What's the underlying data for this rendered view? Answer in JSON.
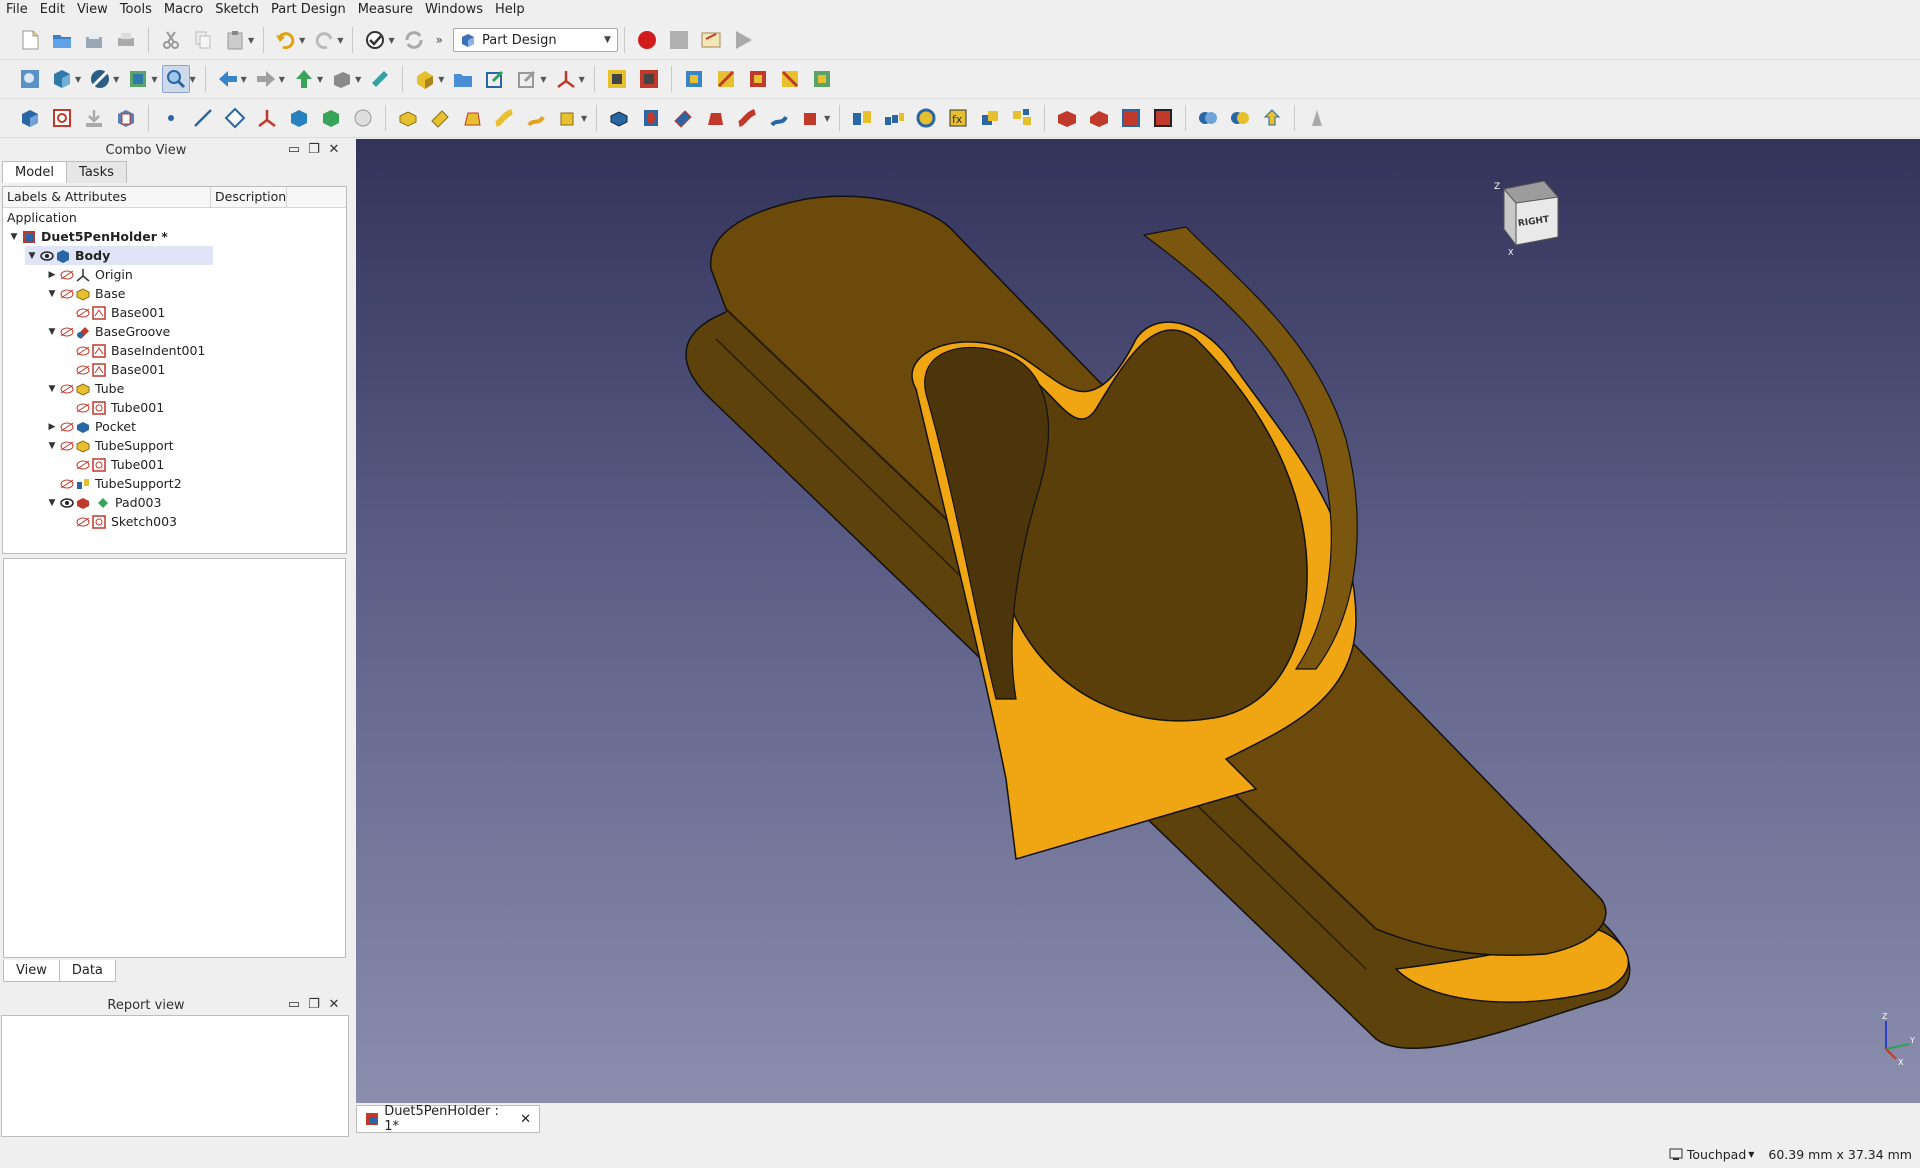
{
  "menu": [
    {
      "label": "File"
    },
    {
      "label": "Edit"
    },
    {
      "label": "View"
    },
    {
      "label": "Tools"
    },
    {
      "label": "Macro"
    },
    {
      "label": "Sketch"
    },
    {
      "label": "Part Design"
    },
    {
      "label": "Measure"
    },
    {
      "label": "Windows"
    },
    {
      "label": "Help"
    }
  ],
  "toolbar": {
    "workbench_selected": "Part Design"
  },
  "combo_view": {
    "title": "Combo View",
    "tabs": [
      "Model",
      "Tasks"
    ],
    "columns": [
      "Labels & Attributes",
      "Description"
    ],
    "tree": [
      {
        "label": "Application"
      },
      {
        "label": "Duet5PenHolder *"
      },
      {
        "label": "Body"
      },
      {
        "label": "Origin"
      },
      {
        "label": "Base"
      },
      {
        "label": "Base001"
      },
      {
        "label": "BaseGroove"
      },
      {
        "label": "BaseIndent001"
      },
      {
        "label": "Base001"
      },
      {
        "label": "Tube"
      },
      {
        "label": "Tube001"
      },
      {
        "label": "Pocket"
      },
      {
        "label": "TubeSupport"
      },
      {
        "label": "Tube001"
      },
      {
        "label": "TubeSupport2"
      },
      {
        "label": "Pad003"
      },
      {
        "label": "Sketch003"
      }
    ],
    "property_tabs": [
      "View",
      "Data"
    ]
  },
  "report_view": {
    "title": "Report view"
  },
  "viewport": {
    "navcube_face": "RIGHT"
  },
  "document_tab": {
    "label": "Duet5PenHolder : 1*"
  },
  "status": {
    "navigation": "Touchpad",
    "dimensions": "60.39 mm x 37.34 mm"
  },
  "colors": {
    "model_dark": "#6b4a0c",
    "model_light": "#f0a512",
    "bg_top": "#33335a",
    "bg_bottom": "#8b8ead"
  }
}
